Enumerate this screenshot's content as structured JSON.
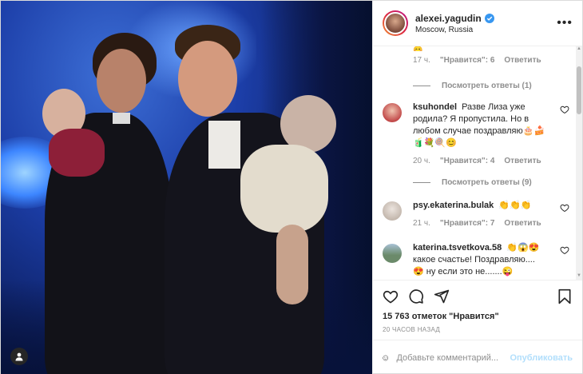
{
  "header": {
    "username": "alexei.yagudin",
    "location": "Moscow, Russia",
    "more_label": "•••"
  },
  "partial_comment": {
    "time": "17 ч.",
    "likes": "\"Нравится\": 6",
    "reply": "Ответить"
  },
  "replies_1": "Посмотреть ответы (1)",
  "comments": [
    {
      "user": "ksuhondel",
      "text": "Разве Лиза уже родила? Я пропустила. Но в любом случае поздравляю🎂🍰🧃💐🍭😊",
      "time": "20 ч.",
      "likes": "\"Нравится\": 4",
      "reply": "Ответить",
      "avatar_color": "#c24a4a"
    },
    {
      "user": "psy.ekaterina.bulak",
      "text": "👏👏👏",
      "time": "21 ч.",
      "likes": "\"Нравится\": 7",
      "reply": "Ответить",
      "avatar_color": "#c4b8ae"
    },
    {
      "user": "katerina.tsvetkova.58",
      "text": "👏😱😍 какое счастье! Поздравляю.... 😍 ну если это не.......😜",
      "avatar_color": "#6b8a6a"
    }
  ],
  "replies_2": "Посмотреть ответы (9)",
  "likes_count": "15 763 отметок \"Нравится\"",
  "post_time": "20 ЧАСОВ НАЗАД",
  "comment_input": {
    "placeholder": "Добавьте комментарий...",
    "publish_label": "Опубликовать"
  },
  "icons": [
    "user-tag-icon",
    "verified-icon",
    "heart-icon",
    "comment-icon",
    "share-icon",
    "bookmark-icon",
    "emoji-icon"
  ],
  "colors": {
    "accent": "#0095f6",
    "publish_disabled": "#b2dffc",
    "verified": "#3897f0",
    "muted": "#8e8e8e"
  }
}
